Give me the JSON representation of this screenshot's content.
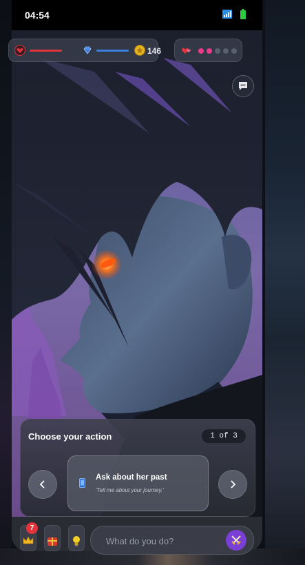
{
  "status_bar": {
    "time": "04:54"
  },
  "hud": {
    "health_level": 1.0,
    "mana_level": 1.0,
    "coins": "146",
    "affection": {
      "filled": 2,
      "total": 5
    }
  },
  "choice_panel": {
    "title": "Choose your action",
    "counter": "1 of 3",
    "option": {
      "label": "Ask about her past",
      "subtitle": "'Tell me about your journey.'"
    }
  },
  "bottom_bar": {
    "badge_count": "7",
    "input_placeholder": "What do you do?"
  },
  "colors": {
    "accent": "#7a3fd4",
    "health": "#e2343a",
    "mana": "#3d7fe0",
    "coin": "#e7b21f",
    "heart_dot": "#ec3a8b",
    "empty_dot": "#5b5f6b"
  },
  "icons": [
    "heart-icon",
    "diamond-icon",
    "star-coin-icon",
    "hearts-icon",
    "chat-icon",
    "device-icon",
    "chevron-left-icon",
    "chevron-right-icon",
    "crown-icon",
    "gift-icon",
    "lightbulb-icon",
    "swords-icon"
  ]
}
